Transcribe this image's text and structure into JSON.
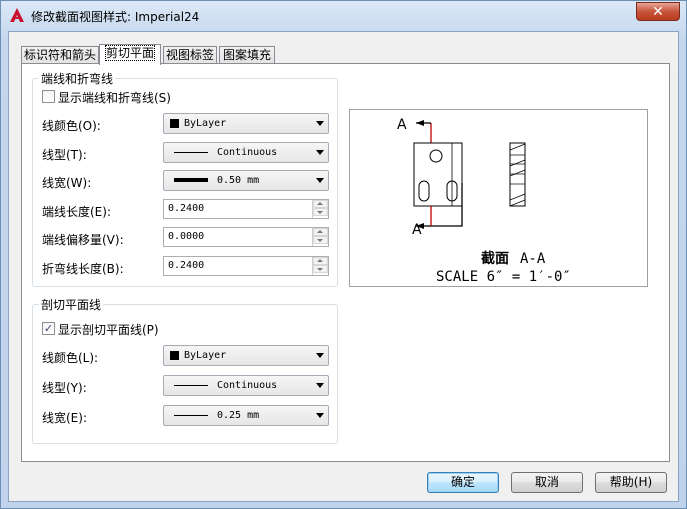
{
  "window": {
    "title": "修改截面视图样式: Imperial24",
    "close_glyph": "✕"
  },
  "tabs": [
    {
      "label": "标识符和箭头"
    },
    {
      "label": "剪切平面"
    },
    {
      "label": "视图标签"
    },
    {
      "label": "图案填充"
    }
  ],
  "end_lines": {
    "group_title": "端线和折弯线",
    "show_checkbox_label": "显示端线和折弯线(S)",
    "show_checked": false,
    "line_color_label": "线颜色(O):",
    "line_color_value": "ByLayer",
    "linetype_label": "线型(T):",
    "linetype_value": "Continuous",
    "lineweight_label": "线宽(W):",
    "lineweight_value": "0.50 mm",
    "end_line_length_label": "端线长度(E):",
    "end_line_length_value": "0.2400",
    "end_line_offset_label": "端线偏移量(V):",
    "end_line_offset_value": "0.0000",
    "bend_line_length_label": "折弯线长度(B):",
    "bend_line_length_value": "0.2400"
  },
  "cutting_plane": {
    "group_title": "剖切平面线",
    "show_checkbox_label": "显示剖切平面线(P)",
    "show_checked": true,
    "line_color_label": "线颜色(L):",
    "line_color_value": "ByLayer",
    "linetype_label": "线型(Y):",
    "linetype_value": "Continuous",
    "lineweight_label": "线宽(E):",
    "lineweight_value": "0.25 mm"
  },
  "preview": {
    "label_a_top": "A",
    "label_a_bottom": "A",
    "section_word": "截面",
    "section_id": "A-A",
    "scale_text": "SCALE 6″ = 1′-0″"
  },
  "buttons": {
    "ok": "确定",
    "cancel": "取消",
    "help": "帮助(H)"
  }
}
